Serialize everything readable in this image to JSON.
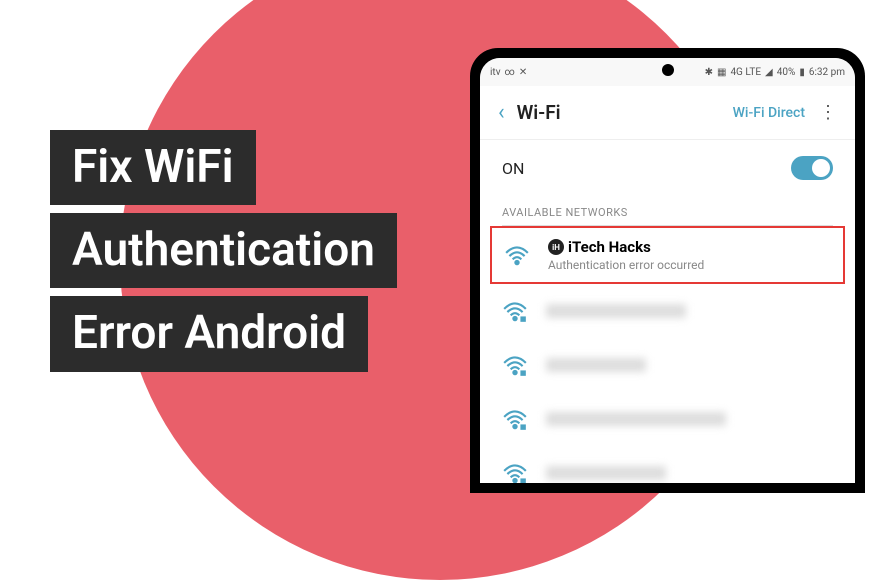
{
  "title": {
    "line1": "Fix WiFi",
    "line2": "Authentication",
    "line3": "Error Android"
  },
  "statusBar": {
    "carrier": "itv",
    "signal": "4G LTE",
    "battery": "40%",
    "time": "6:32 pm"
  },
  "wifiHeader": {
    "back": "‹",
    "title": "Wi-Fi",
    "direct": "Wi-Fi Direct",
    "menu": "⋮"
  },
  "toggle": {
    "label": "ON",
    "state": true
  },
  "sectionHeader": "AVAILABLE NETWORKS",
  "networks": {
    "highlighted": {
      "logo": "iH",
      "name": "iTech Hacks",
      "status": "Authentication error occurred"
    }
  }
}
